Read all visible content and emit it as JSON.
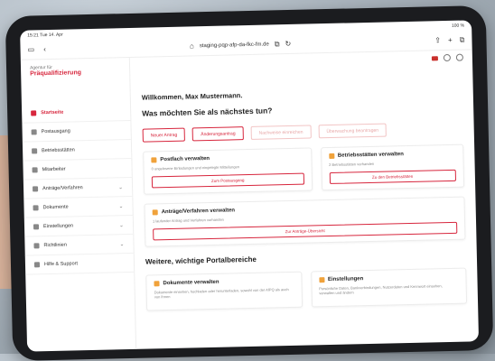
{
  "status": {
    "time": "15:21",
    "day": "Tue 14. Apr",
    "battery": "100 %"
  },
  "browser": {
    "url": "staging-pqp-afp-da-fkc-fm.de"
  },
  "logo": {
    "line1": "Agentur für",
    "line2": "Präqualifizierung"
  },
  "sidebar": {
    "items": [
      {
        "label": "Startseite"
      },
      {
        "label": "Postausgang"
      },
      {
        "label": "Betriebsstätten"
      },
      {
        "label": "Mitarbeiter"
      },
      {
        "label": "Anträge/Verfahren"
      },
      {
        "label": "Dokumente"
      },
      {
        "label": "Einstellungen"
      },
      {
        "label": "Richtlinien"
      },
      {
        "label": "Hilfe & Support"
      }
    ]
  },
  "main": {
    "welcome": "Willkommen, Max Mustermann.",
    "question": "Was möchten Sie als nächstes tun?",
    "actions": [
      "Neuer Antrag",
      "Änderungsantrag",
      "Nachweise einreichen",
      "Überwachung beantragen"
    ],
    "cards": {
      "postfach": {
        "title": "Postfach verwalten",
        "desc": "0 ungelesene Einladungen und eingelegte Mitteilungen",
        "button": "Zum Postausgang"
      },
      "betrieb": {
        "title": "Betriebsstätten verwalten",
        "desc": "2 Betriebsstätten vorhanden",
        "button": "Zu den Betriebsstätten"
      },
      "antraege": {
        "title": "Anträge/Verfahren verwalten",
        "desc": "1 laufender Antrag und Verfahren vorhanden",
        "button": "Zur Anträge-Übersicht"
      },
      "dokumente": {
        "title": "Dokumente verwalten",
        "desc": "Dokumente einsehen, hochladen oder herunterladen, sowohl von der AfPQ als auch von Ihnen"
      },
      "einstellungen": {
        "title": "Einstellungen",
        "desc": "Persönliche Daten, Bankverbindungen, Nutzerdaten und Kennwort einsehen, verwalten und ändern"
      }
    },
    "section": "Weitere, wichtige Portalbereiche"
  },
  "colors": {
    "accent": "#d7263d",
    "warning": "#f0a23b"
  }
}
